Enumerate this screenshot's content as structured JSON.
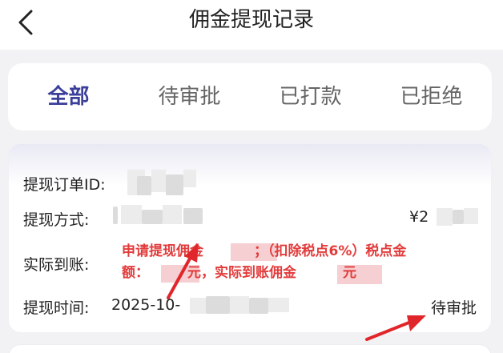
{
  "header": {
    "title": "佣金提现记录",
    "back_icon": "chevron-left-icon"
  },
  "tabs": [
    {
      "label": "全部",
      "active": true
    },
    {
      "label": "待审批",
      "active": false
    },
    {
      "label": "已打款",
      "active": false
    },
    {
      "label": "已拒绝",
      "active": false
    }
  ],
  "record": {
    "order_id_label": "提现订单ID:",
    "method_label": "提现方式:",
    "amount_prefix": "¥2",
    "actual_label": "实际到账:",
    "note_line1_a": "申请提现佣金",
    "note_line1_b": "；（扣除税点6%）税点金",
    "note_line2_a": "额：",
    "note_line2_b": "元，实际到账佣金",
    "note_line2_c": "元",
    "time_label": "提现时间:",
    "time_value": "2025-10-",
    "status": "待审批"
  },
  "colors": {
    "accent": "#3b3f9a",
    "note_red": "#e23b3b",
    "arrow_red": "#e0262a",
    "background": "#f2f2f4"
  }
}
